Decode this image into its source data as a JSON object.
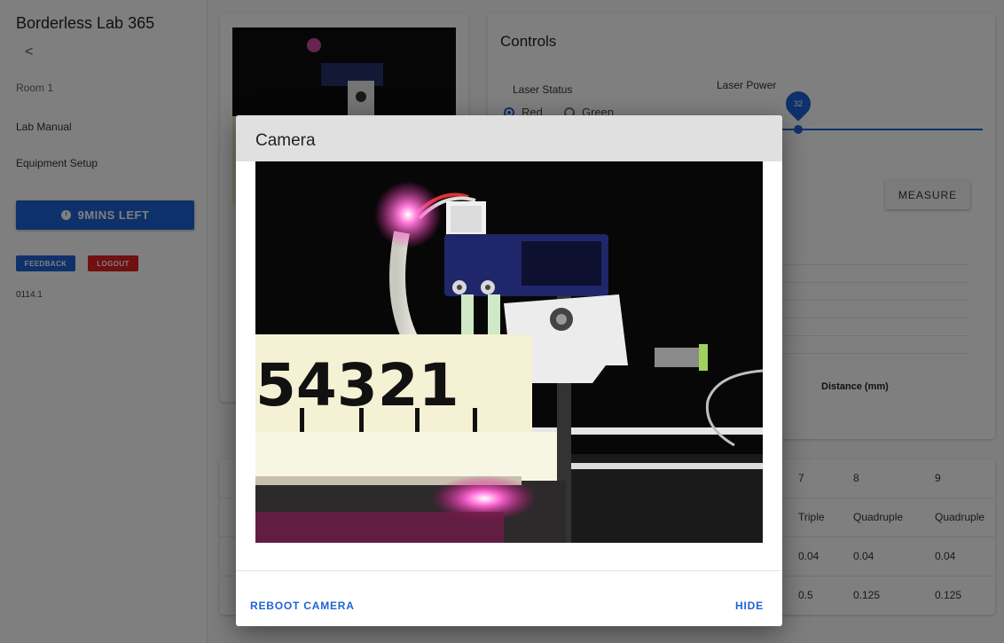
{
  "sidebar": {
    "app_title": "Borderless Lab 365",
    "back_label": "<",
    "room": "Room 1",
    "lab_manual": "Lab Manual",
    "equipment_setup": "Equipment Setup",
    "timer_label": "9MINS LEFT",
    "feedback_label": "FEEDBACK",
    "logout_label": "LOGOUT",
    "version": "0114.1"
  },
  "controls": {
    "title": "Controls",
    "laser_status_label": "Laser Status",
    "laser_power_label": "Laser Power",
    "laser_power_value": "32",
    "radio_red": "Red",
    "radio_green": "Green",
    "measure_label": "MEASURE",
    "distance_label": "Distance (mm)"
  },
  "table": {
    "header": [
      "7",
      "8",
      "9"
    ],
    "row1": [
      "Triple",
      "Quadruple",
      "Quadruple"
    ],
    "row2": [
      "0.04",
      "0.04",
      "0.04"
    ],
    "row3": [
      "0.5",
      "0.125",
      "0.125"
    ]
  },
  "dialog": {
    "title": "Camera",
    "reboot_label": "REBOOT CAMERA",
    "hide_label": "HIDE",
    "ruler_digits": "54321"
  }
}
